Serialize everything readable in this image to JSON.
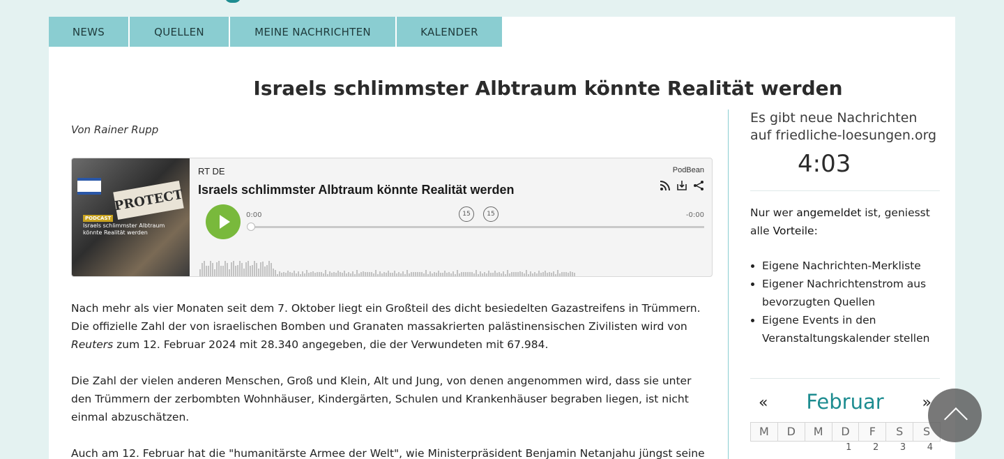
{
  "nav": {
    "items": [
      "NEWS",
      "QUELLEN",
      "MEINE NACHRICHTEN",
      "KALENDER"
    ]
  },
  "article": {
    "title": "Israels schlimmster Albtraum könnte Realität werden",
    "author": "Von Rainer Rupp",
    "paragraphs": [
      {
        "before": "Nach mehr als vier Monaten seit dem 7. Oktober liegt ein Großteil des dicht besiedelten Gazastreifens in Trümmern. Die offizielle Zahl der von israelischen Bomben und Granaten massakrierten palästinensischen Zivilisten wird von ",
        "em": "Reuters",
        "after": " zum 12. Februar 2024 mit 28.340 angegeben, die der Verwundeten mit 67.984."
      },
      {
        "before": "Die Zahl der vielen anderen Menschen, Groß und Klein, Alt und Jung, von denen angenommen wird, dass sie unter den Trümmern der zerbombten Wohnhäuser, Kindergärten, Schulen und Krankenhäuser begraben liegen, ist nicht einmal abzuschätzen.",
        "em": "",
        "after": ""
      },
      {
        "before": "Auch am 12. Februar hat die \"humanitärste Armee der Welt\", wie Ministerpräsident Benjamin Netanjahu jüngst seine",
        "em": "",
        "after": ""
      }
    ]
  },
  "player": {
    "channel": "RT DE",
    "title": "Israels schlimmster Albtraum könnte Realität werden",
    "brand": "PodBean",
    "time_current": "0:00",
    "time_remaining": "-0:00",
    "skip_back_label": "15",
    "skip_forward_label": "15",
    "progress": 0,
    "cover": {
      "sign_text": "PROTECT",
      "badge": "PODCAST",
      "caption": "Israels schlimmster Albtraum könnte Realität werden"
    },
    "icons": [
      "rss-icon",
      "download-icon",
      "share-icon"
    ],
    "accent_color": "#79b93c"
  },
  "sidebar": {
    "notice": "Es gibt neue Nachrichten auf friedliche-loesungen.org",
    "clock": "4:03",
    "login_text": {
      "prefix": "Nur wer ",
      "link1": "angemeldet",
      "middle": " ist, geniesst alle ",
      "link2": "Vorteile",
      "suffix": ":"
    },
    "benefits": [
      "Eigene Nachrichten-Merkliste",
      "Eigener Nachrichtenstrom aus bevorzugten Quellen",
      "Eigene Events in den Veranstaltungskalender stellen"
    ]
  },
  "calendar": {
    "prev": "«",
    "month": "Februar",
    "next": "»",
    "weekdays": [
      "M",
      "D",
      "M",
      "D",
      "F",
      "S",
      "S"
    ],
    "first_row": [
      "",
      "",
      "",
      "1",
      "2",
      "3",
      "4"
    ]
  },
  "colors": {
    "background": "#e4f2f1",
    "nav": "#8acdd1",
    "accent": "#1d8c90"
  }
}
